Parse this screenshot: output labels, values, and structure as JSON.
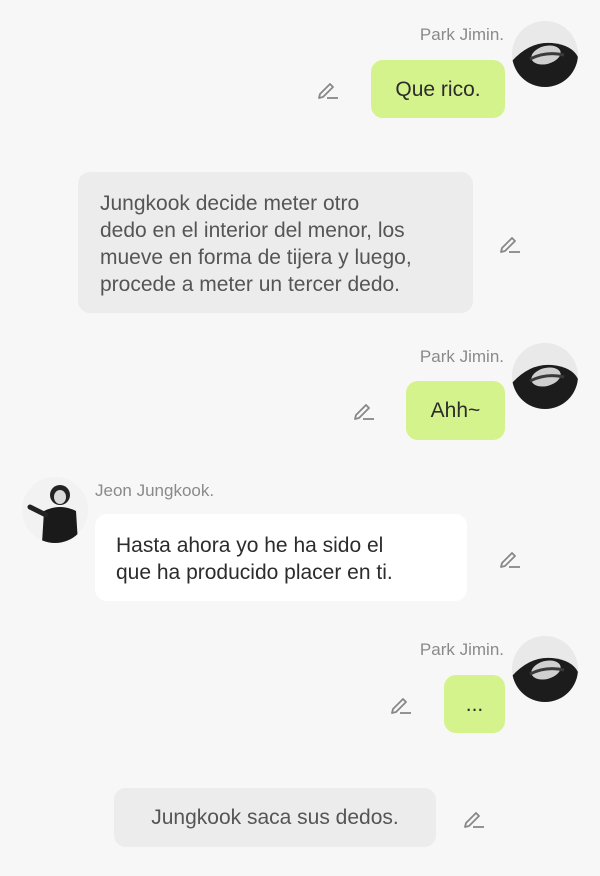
{
  "colors": {
    "background": "#f7f7f7",
    "outgoing_bubble": "#d5f38c",
    "incoming_bubble": "#ffffff",
    "narration_bubble": "#ececec",
    "name_text": "#8a8a8a"
  },
  "messages": [
    {
      "type": "outgoing",
      "sender": "Park Jimin.",
      "text": "Que rico.",
      "avatar_icon": "park-jimin-avatar",
      "action_icon": "edit-pencil-icon"
    },
    {
      "type": "narration",
      "text": "Jungkook decide meter otro\ndedo en el interior del menor, los\nmueve en forma de tijera y luego,\nprocede a meter un tercer dedo.",
      "action_icon": "edit-pencil-icon"
    },
    {
      "type": "outgoing",
      "sender": "Park Jimin.",
      "text": "Ahh~",
      "avatar_icon": "park-jimin-avatar",
      "action_icon": "edit-pencil-icon"
    },
    {
      "type": "incoming",
      "sender": "Jeon Jungkook.",
      "text": "Hasta ahora yo he ha sido el\nque ha producido placer en ti.",
      "avatar_icon": "jeon-jungkook-avatar",
      "action_icon": "edit-pencil-icon"
    },
    {
      "type": "outgoing",
      "sender": "Park Jimin.",
      "text": "...",
      "avatar_icon": "park-jimin-avatar",
      "action_icon": "edit-pencil-icon"
    },
    {
      "type": "narration",
      "text": "Jungkook saca sus dedos.",
      "action_icon": "edit-pencil-icon"
    }
  ]
}
